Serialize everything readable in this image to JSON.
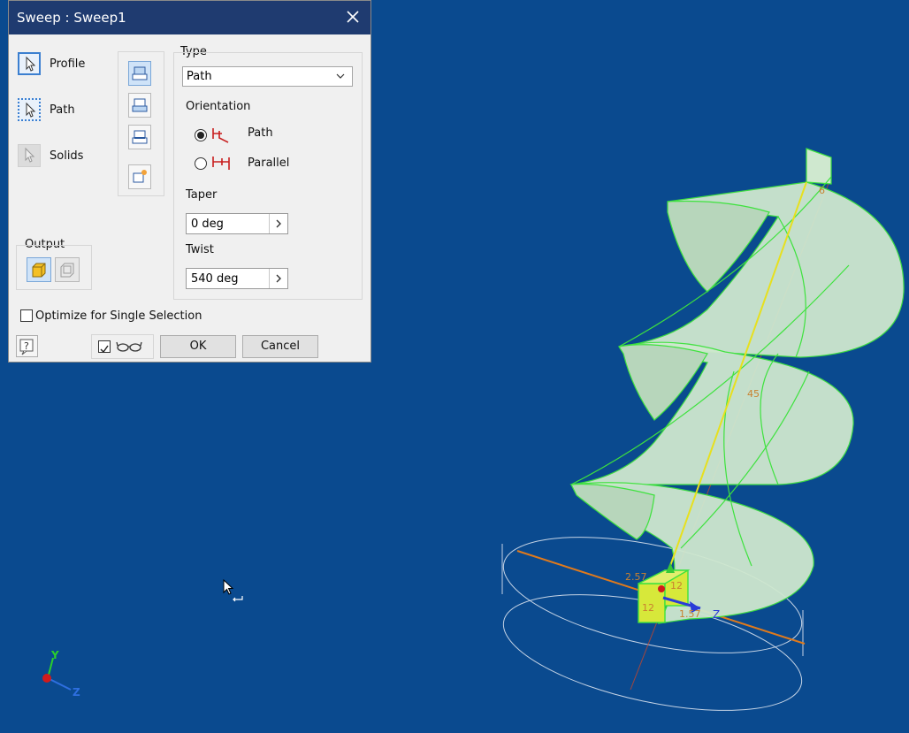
{
  "dialog": {
    "title": "Sweep : Sweep1",
    "selectors": [
      {
        "label": "Profile"
      },
      {
        "label": "Path"
      },
      {
        "label": "Solids"
      }
    ],
    "output_label": "Output",
    "type_label": "Type",
    "type_value": "Path",
    "orientation_label": "Orientation",
    "orientation_options": [
      "Path",
      "Parallel"
    ],
    "orientation_selected": "Path",
    "taper_label": "Taper",
    "taper_value": "0 deg",
    "twist_label": "Twist",
    "twist_value": "540 deg",
    "optimize_label": "Optimize for Single Selection",
    "optimize_checked": false,
    "preview_checked": true,
    "ok_label": "OK",
    "cancel_label": "Cancel"
  },
  "viewport": {
    "background_color": "#0a4a8f",
    "dimension_labels": [
      "2.57",
      "12",
      "12",
      "1.57",
      "45",
      "6"
    ],
    "triad_axes": [
      "Y",
      "Z"
    ],
    "origin_axis_label": "Z"
  }
}
